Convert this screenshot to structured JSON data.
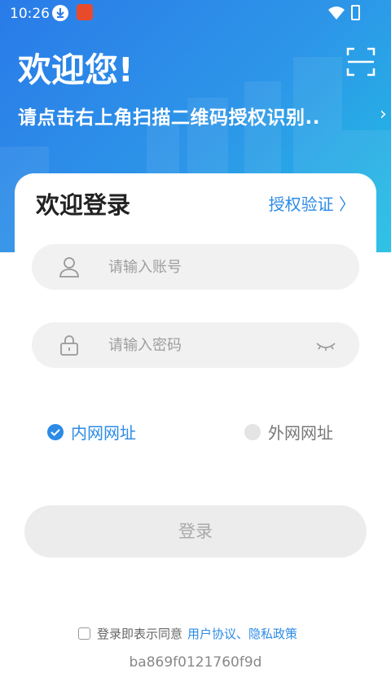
{
  "status_bar": {
    "time": "10:26"
  },
  "header": {
    "welcome": "欢迎您!",
    "subtitle": "请点击右上角扫描二维码授权识别..",
    "scan_icon": "qr-scan-icon"
  },
  "card": {
    "title": "欢迎登录",
    "auth_link": "授权验证 〉"
  },
  "form": {
    "account_placeholder": "请输入账号",
    "password_placeholder": "请输入密码"
  },
  "network": {
    "intranet_label": "内网网址",
    "extranet_label": "外网网址",
    "selected": "intranet"
  },
  "login_button": "登录",
  "agreement": {
    "text": "登录即表示同意",
    "links": "用户协议、隐私政策"
  },
  "device_id": "ba869f0121760f9d",
  "colors": {
    "accent": "#2c8be6",
    "header_start": "#2a7be8",
    "header_end": "#21bfe4"
  }
}
